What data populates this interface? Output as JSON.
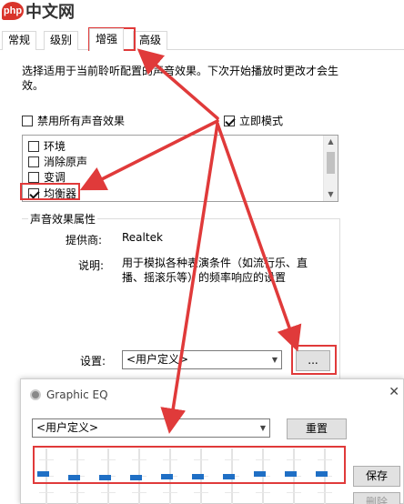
{
  "watermark": {
    "logo": "php",
    "text": "中文网"
  },
  "tabs": [
    {
      "label": "常规"
    },
    {
      "label": "级别"
    },
    {
      "label": "增强"
    },
    {
      "label": "高级"
    }
  ],
  "description": "选择适用于当前聆听配置的声音效果。下次开始播放时更改才会生效。",
  "disable_all": {
    "label": "禁用所有声音效果",
    "checked": false
  },
  "immediate_mode": {
    "label": "立即模式",
    "checked": true
  },
  "effects": [
    {
      "label": "环境",
      "checked": false
    },
    {
      "label": "消除原声",
      "checked": false
    },
    {
      "label": "变调",
      "checked": false
    },
    {
      "label": "均衡器",
      "checked": true
    }
  ],
  "properties": {
    "group_title": "声音效果属性",
    "provider_label": "提供商:",
    "provider_value": "Realtek",
    "desc_label": "说明:",
    "desc_value": "用于模拟各种表演条件（如流行乐、直播、摇滚乐等）的频率响应的设置",
    "setting_label": "设置:",
    "setting_value": "<用户定义>",
    "more_button": "..."
  },
  "eq_window": {
    "title": "Graphic EQ",
    "preset_value": "<用户定义>",
    "reset_button": "重置",
    "save_button": "保存",
    "delete_button": "删除",
    "bands": [
      0.4,
      0.47,
      0.47,
      0.47,
      0.45,
      0.45,
      0.45,
      0.4,
      0.4,
      0.4
    ]
  },
  "colors": {
    "annotation": "#e03a3a",
    "accent": "#1f6fc5"
  }
}
